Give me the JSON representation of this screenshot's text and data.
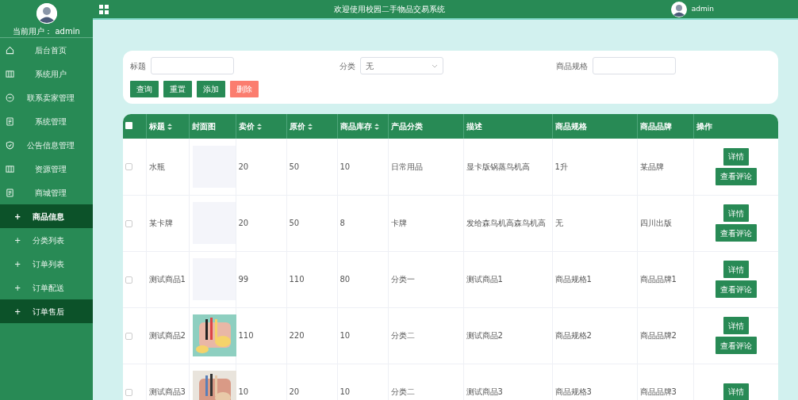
{
  "sidebar": {
    "user_label": "当前用户：",
    "user_name": "admin",
    "items": [
      {
        "label": "后台首页",
        "selected": false,
        "hovered": false,
        "kind": "main"
      },
      {
        "label": "系统用户",
        "selected": false,
        "hovered": false,
        "kind": "main"
      },
      {
        "label": "联系卖家管理",
        "selected": false,
        "hovered": false,
        "kind": "main"
      },
      {
        "label": "系统管理",
        "selected": false,
        "hovered": false,
        "kind": "main"
      },
      {
        "label": "公告信息管理",
        "selected": false,
        "hovered": false,
        "kind": "main"
      },
      {
        "label": "资源管理",
        "selected": false,
        "hovered": false,
        "kind": "main"
      },
      {
        "label": "商城管理",
        "selected": false,
        "hovered": false,
        "kind": "main"
      },
      {
        "label": "商品信息",
        "selected": true,
        "hovered": false,
        "kind": "sub",
        "expand_sign": "+"
      },
      {
        "label": "分类列表",
        "selected": false,
        "hovered": false,
        "kind": "sub",
        "expand_sign": "+"
      },
      {
        "label": "订单列表",
        "selected": false,
        "hovered": false,
        "kind": "sub",
        "expand_sign": "+"
      },
      {
        "label": "订单配送",
        "selected": false,
        "hovered": false,
        "kind": "sub",
        "expand_sign": "+"
      },
      {
        "label": "订单售后",
        "selected": false,
        "hovered": true,
        "kind": "sub",
        "expand_sign": "+"
      }
    ]
  },
  "header": {
    "title": "欢迎使用校园二手物品交易系统",
    "user_name": "admin"
  },
  "search": {
    "fields": [
      {
        "label": "标题",
        "kind": "input"
      },
      {
        "label": "分类",
        "kind": "select",
        "value": "无"
      },
      {
        "label": "商品规格",
        "kind": "input"
      }
    ],
    "buttons": [
      {
        "label": "查询",
        "kind": "primary"
      },
      {
        "label": "重置",
        "kind": "primary"
      },
      {
        "label": "添加",
        "kind": "primary"
      },
      {
        "label": "删除",
        "kind": "danger"
      }
    ]
  },
  "table": {
    "all_checked": false,
    "columns": [
      {
        "label": "标题",
        "sortable": true
      },
      {
        "label": "封面图",
        "sortable": false
      },
      {
        "label": "卖价",
        "sortable": true
      },
      {
        "label": "原价",
        "sortable": true
      },
      {
        "label": "商品库存",
        "sortable": true
      },
      {
        "label": "产品分类",
        "sortable": false
      },
      {
        "label": "描述",
        "sortable": false
      },
      {
        "label": "商品规格",
        "sortable": false
      },
      {
        "label": "商品品牌",
        "sortable": false
      },
      {
        "label": "操作",
        "sortable": false
      }
    ],
    "rows": [
      {
        "checked": false,
        "cells": [
          "水瓶",
          "",
          "20",
          "50",
          "10",
          "日常用品",
          "显卡版锅蒸鸟机高",
          "1升",
          "某品牌"
        ],
        "cover": {
          "kind": "empty"
        },
        "actions": [
          "详情",
          "查看评论"
        ]
      },
      {
        "checked": false,
        "cells": [
          "某卡牌",
          "",
          "20",
          "50",
          "8",
          "卡牌",
          "发给森鸟机高森鸟机高",
          "无",
          "四川出版"
        ],
        "cover": {
          "kind": "empty"
        },
        "actions": [
          "详情",
          "查看评论"
        ]
      },
      {
        "checked": false,
        "cells": [
          "测试商品1",
          "",
          "99",
          "110",
          "80",
          "分类一",
          "测试商品1",
          "商品规格1",
          "商品品牌1"
        ],
        "cover": {
          "kind": "empty"
        },
        "actions": [
          "详情",
          "查看评论"
        ]
      },
      {
        "checked": false,
        "cells": [
          "测试商品2",
          "",
          "110",
          "220",
          "10",
          "分类二",
          "测试商品2",
          "商品规格2",
          "商品品牌2"
        ],
        "cover": {
          "kind": "picture"
        },
        "actions": [
          "详情",
          "查看评论"
        ]
      },
      {
        "checked": false,
        "cells": [
          "测试商品3",
          "",
          "10",
          "20",
          "10",
          "分类二",
          "测试商品3",
          "商品规格3",
          "商品品牌3"
        ],
        "cover": {
          "kind": "picture"
        },
        "actions": [
          "详情"
        ]
      }
    ]
  }
}
